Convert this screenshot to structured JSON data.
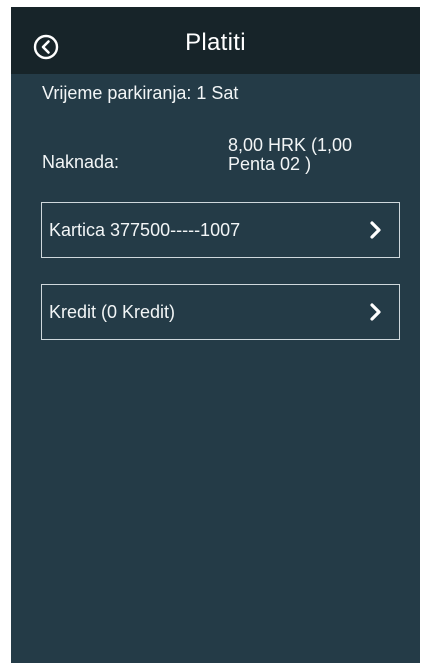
{
  "header": {
    "title": "Platiti",
    "back_icon": "back-circle-icon"
  },
  "details": {
    "duration_text": "Vrijeme parkiranja: 1 Sat",
    "fee_label": "Naknada:",
    "fee_value_line1": "8,00 HRK (1,00",
    "fee_value_line2": "Penta 02 )"
  },
  "payment_options": [
    {
      "label": "Kartica 377500-----1007",
      "icon": "chevron-right-icon"
    },
    {
      "label": "Kredit (0 Kredit)",
      "icon": "chevron-right-icon"
    }
  ],
  "colors": {
    "header_bg": "#172429",
    "body_bg": "#243b47",
    "text": "#f2f5f6",
    "border": "#cfd8dc"
  }
}
